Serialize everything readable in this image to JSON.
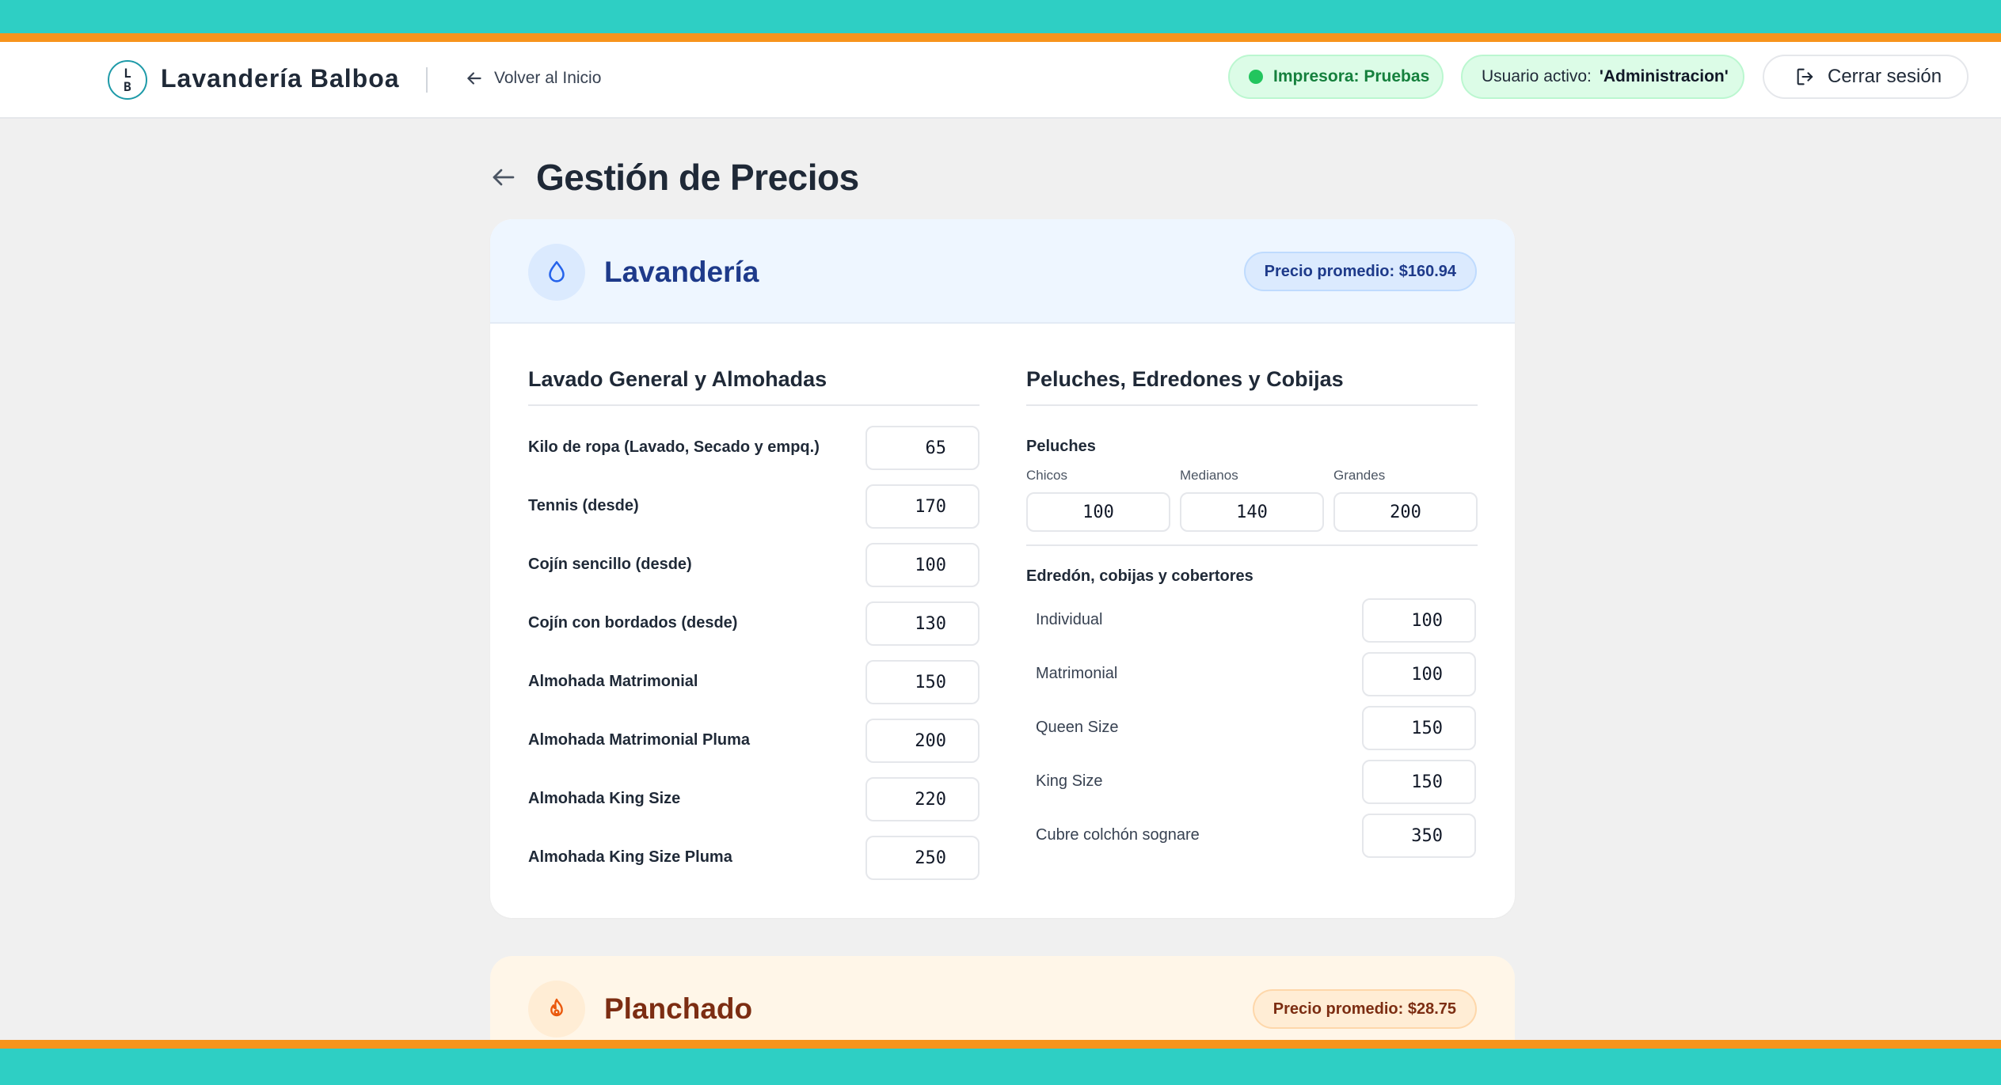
{
  "header": {
    "logo_top": "L",
    "logo_bottom": "B",
    "brand": "Lavandería Balboa",
    "back_home": "Volver al Inicio",
    "printer": "Impresora: Pruebas",
    "user_label": "Usuario activo:",
    "user_name": "'Administracion'",
    "logout": "Cerrar sesión"
  },
  "page": {
    "title": "Gestión de Precios"
  },
  "lavanderia": {
    "title": "Lavandería",
    "average": "Precio promedio: $160.94",
    "general": {
      "title": "Lavado General y Almohadas",
      "items": [
        {
          "label": "Kilo de ropa (Lavado, Secado y empq.)",
          "value": "65"
        },
        {
          "label": "Tennis (desde)",
          "value": "170"
        },
        {
          "label": "Cojín sencillo (desde)",
          "value": "100"
        },
        {
          "label": "Cojín con bordados (desde)",
          "value": "130"
        },
        {
          "label": "Almohada Matrimonial",
          "value": "150"
        },
        {
          "label": "Almohada Matrimonial Pluma",
          "value": "200"
        },
        {
          "label": "Almohada King Size",
          "value": "220"
        },
        {
          "label": "Almohada King Size Pluma",
          "value": "250"
        }
      ]
    },
    "peluches_section": {
      "title": "Peluches, Edredones y Cobijas",
      "peluches": {
        "title": "Peluches",
        "sizes": [
          {
            "label": "Chicos",
            "value": "100"
          },
          {
            "label": "Medianos",
            "value": "140"
          },
          {
            "label": "Grandes",
            "value": "200"
          }
        ]
      },
      "edredon": {
        "title": "Edredón, cobijas y cobertores",
        "items": [
          {
            "label": "Individual",
            "value": "100"
          },
          {
            "label": "Matrimonial",
            "value": "100"
          },
          {
            "label": "Queen Size",
            "value": "150"
          },
          {
            "label": "King Size",
            "value": "150"
          },
          {
            "label": "Cubre colchón sognare",
            "value": "350"
          }
        ]
      }
    }
  },
  "planchado": {
    "title": "Planchado",
    "average": "Precio promedio: $28.75"
  },
  "colors": {
    "teal": "#2ecfc4",
    "orange": "#f7941d",
    "blue_title": "#1e3a8a",
    "brown_title": "#7c2d12"
  }
}
